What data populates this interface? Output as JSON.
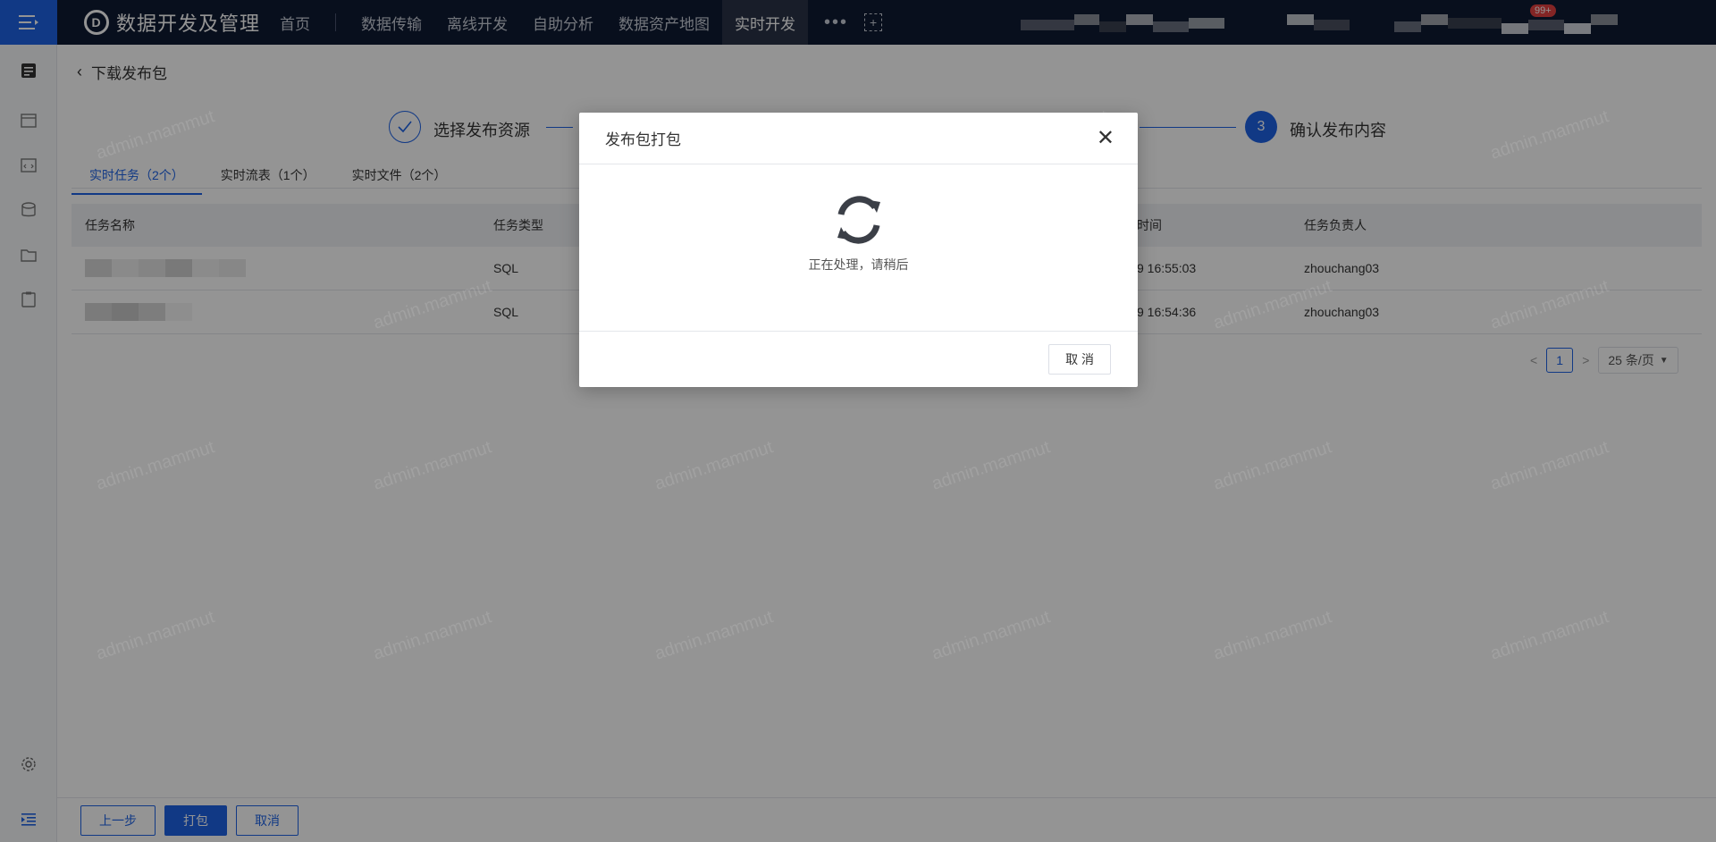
{
  "topbar": {
    "app_title": "数据开发及管理",
    "nav": [
      {
        "label": "首页"
      },
      {
        "label": "数据传输"
      },
      {
        "label": "离线开发"
      },
      {
        "label": "自助分析"
      },
      {
        "label": "数据资产地图"
      },
      {
        "label": "实时开发"
      }
    ],
    "more": "•••",
    "add": "+",
    "badge": "99+"
  },
  "page": {
    "back_title": "下载发布包"
  },
  "steps": {
    "step1_label": "选择发布资源",
    "step3_number": "3",
    "step3_label": "确认发布内容"
  },
  "tabs": [
    {
      "label": "实时任务（2个）"
    },
    {
      "label": "实时流表（1个）"
    },
    {
      "label": "实时文件（2个）"
    }
  ],
  "table": {
    "columns": [
      "任务名称",
      "任务类型",
      "时间",
      "任务负责人"
    ],
    "rows": [
      {
        "type": "SQL",
        "time": "9 16:55:03",
        "owner": "zhouchang03"
      },
      {
        "type": "SQL",
        "time": "9 16:54:36",
        "owner": "zhouchang03"
      }
    ]
  },
  "pager": {
    "prev": "<",
    "page": "1",
    "next": ">",
    "page_size": "25 条/页"
  },
  "footer": {
    "prev_label": "上一步",
    "pack_label": "打包",
    "cancel_label": "取消"
  },
  "watermark": "admin.mammut",
  "modal": {
    "title": "发布包打包",
    "close": "✕",
    "message": "正在处理，请稍后",
    "cancel_label": "取 消"
  }
}
